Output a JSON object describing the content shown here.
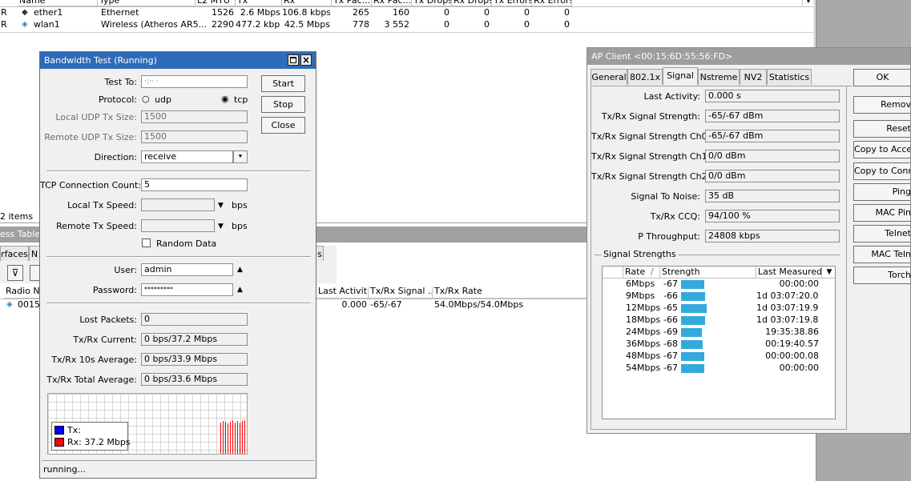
{
  "interfaces_table": {
    "columns": [
      "Name",
      "Type",
      "L2 MTU",
      "Tx",
      "Rx",
      "Tx Pac...",
      "Rx Pac...",
      "Tx Drops",
      "Rx Drops",
      "Tx Errors",
      "Rx Errors"
    ],
    "rows": [
      {
        "flag": "R",
        "name": "ether1",
        "type": "Ethernet",
        "l2mtu": "1526",
        "tx": "2.6 Mbps",
        "rx": "106.8 kbps",
        "txp": "265",
        "rxp": "160",
        "txd": "0",
        "rxd": "0",
        "txe": "0",
        "rxe": "0"
      },
      {
        "flag": "R",
        "name": "wlan1",
        "type": "Wireless (Atheros AR5...",
        "l2mtu": "2290",
        "tx": "477.2 kbps",
        "rx": "42.5 Mbps",
        "txp": "778",
        "rxp": "3 552",
        "txd": "0",
        "rxd": "0",
        "txe": "0",
        "rxe": "0"
      }
    ],
    "items_count": "2 items"
  },
  "registration_panel": {
    "title_fragment": "ess Table",
    "tab_fragment_1": "rfaces",
    "tab_fragment_2": "N",
    "col_radio": "Radio Na",
    "row_radio": "0015",
    "col_last": "Last Activit...",
    "col_signal": "Tx/Rx Signal ...",
    "col_rate": "Tx/Rx Rate",
    "row_last": "0.000",
    "row_signal": "-65/-67",
    "row_rate": "54.0Mbps/54.0Mbps",
    "tab_fragment_3": "s"
  },
  "bandwidth_test": {
    "title": "Bandwidth Test (Running)",
    "test_to_label": "Test To:",
    "test_to_value": "·:··          ·",
    "protocol_label": "Protocol:",
    "protocol_udp": "udp",
    "protocol_tcp": "tcp",
    "local_udp_label": "Local UDP Tx Size:",
    "local_udp_value": "1500",
    "remote_udp_label": "Remote UDP Tx Size:",
    "remote_udp_value": "1500",
    "direction_label": "Direction:",
    "direction_value": "receive",
    "tcp_count_label": "TCP Connection Count:",
    "tcp_count_value": "5",
    "local_speed_label": "Local Tx Speed:",
    "remote_speed_label": "Remote Tx Speed:",
    "bps_unit": "bps",
    "random_data_label": "Random Data",
    "user_label": "User:",
    "user_value": "admin",
    "password_label": "Password:",
    "password_value": "*********",
    "lost_packets_label": "Lost Packets:",
    "lost_packets_value": "0",
    "current_label": "Tx/Rx Current:",
    "current_value": "0 bps/37.2 Mbps",
    "avg10_label": "Tx/Rx 10s Average:",
    "avg10_value": "0 bps/33.9 Mbps",
    "total_label": "Tx/Rx Total Average:",
    "total_value": "0 bps/33.6 Mbps",
    "start_button": "Start",
    "stop_button": "Stop",
    "close_button": "Close",
    "legend_tx": "Tx:",
    "legend_rx": "Rx:  37.2 Mbps",
    "tx_color": "#0000ff",
    "rx_color": "#ff0000",
    "graph_rx_bars": [
      0.92,
      0.98,
      0.95,
      0.9,
      0.96,
      0.99,
      0.93,
      0.97,
      0.94,
      0.98,
      1.0,
      0.95
    ],
    "status": "running..."
  },
  "ap_client": {
    "title": "AP Client <00:15:6D:55:56:FD>",
    "tabs": [
      "General",
      "802.1x",
      "Signal",
      "Nstreme",
      "NV2",
      "Statistics"
    ],
    "active_tab": "Signal",
    "fields": [
      {
        "label": "Last Activity:",
        "value": "0.000 s"
      },
      {
        "label": "Tx/Rx Signal Strength:",
        "value": "-65/-67 dBm"
      },
      {
        "label": "Tx/Rx Signal Strength Ch0:",
        "value": "-65/-67 dBm"
      },
      {
        "label": "Tx/Rx Signal Strength Ch1:",
        "value": "0/0 dBm"
      },
      {
        "label": "Tx/Rx Signal Strength Ch2:",
        "value": "0/0 dBm"
      },
      {
        "label": "Signal To Noise:",
        "value": "35 dB"
      },
      {
        "label": "Tx/Rx CCQ:",
        "value": "94/100 %"
      },
      {
        "label": "P Throughput:",
        "value": "24808 kbps"
      }
    ],
    "signal_strengths_label": "Signal Strengths",
    "table_columns": [
      "Rate",
      "Strength",
      "Last Measured"
    ],
    "signal_rows": [
      {
        "rate": "6Mbps",
        "strength": "-67",
        "last": "00:00:00"
      },
      {
        "rate": "9Mbps",
        "strength": "-66",
        "last": "1d 03:07:20.01"
      },
      {
        "rate": "12Mbps",
        "strength": "-65",
        "last": "1d 03:07:19.95"
      },
      {
        "rate": "18Mbps",
        "strength": "-66",
        "last": "1d 03:07:19.86"
      },
      {
        "rate": "24Mbps",
        "strength": "-69",
        "last": "19:35:38.86"
      },
      {
        "rate": "36Mbps",
        "strength": "-68",
        "last": "00:19:40.57"
      },
      {
        "rate": "48Mbps",
        "strength": "-67",
        "last": "00:00:00.08"
      },
      {
        "rate": "54Mbps",
        "strength": "-67",
        "last": "00:00:00"
      }
    ],
    "bar_color": "#33aadd",
    "buttons": [
      "OK",
      "Remov",
      "Reset",
      "Copy to Acce",
      "Copy to Conn",
      "Ping",
      "MAC Pin",
      "Telnet",
      "MAC Teln",
      "Torch"
    ]
  }
}
